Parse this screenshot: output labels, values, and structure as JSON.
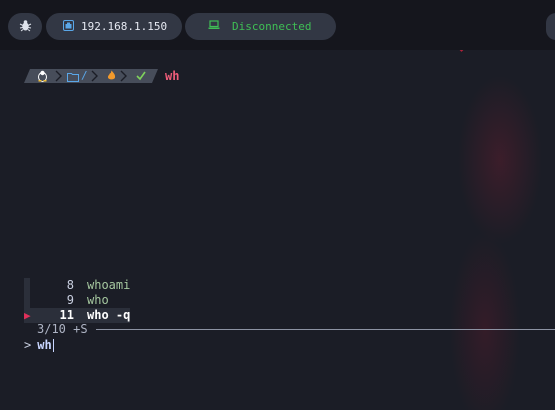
{
  "topbar": {
    "bug_icon": "bug-icon",
    "ip": {
      "icon": "network-icon",
      "label": "192.168.1.150"
    },
    "status": {
      "icon": "laptop-icon",
      "label": "Disconnected",
      "color": "#3fbf55"
    }
  },
  "prompt": {
    "segments": [
      "linux-icon",
      "folder-icon",
      "flame-icon",
      "check-icon"
    ],
    "folder_text": "/",
    "typed": "wh"
  },
  "history": {
    "rows": [
      {
        "num": "8",
        "cmd": "whoami"
      },
      {
        "num": "9",
        "cmd": "who"
      },
      {
        "num": "11",
        "cmd": "who -q",
        "selected": true
      }
    ],
    "pointer": "▶",
    "count": "3/10 +S"
  },
  "input": {
    "prompt": ">",
    "query": "wh"
  },
  "colors": {
    "background": "#1b1d26",
    "accent": "#ef5d7a",
    "status_green": "#3fbf55"
  }
}
